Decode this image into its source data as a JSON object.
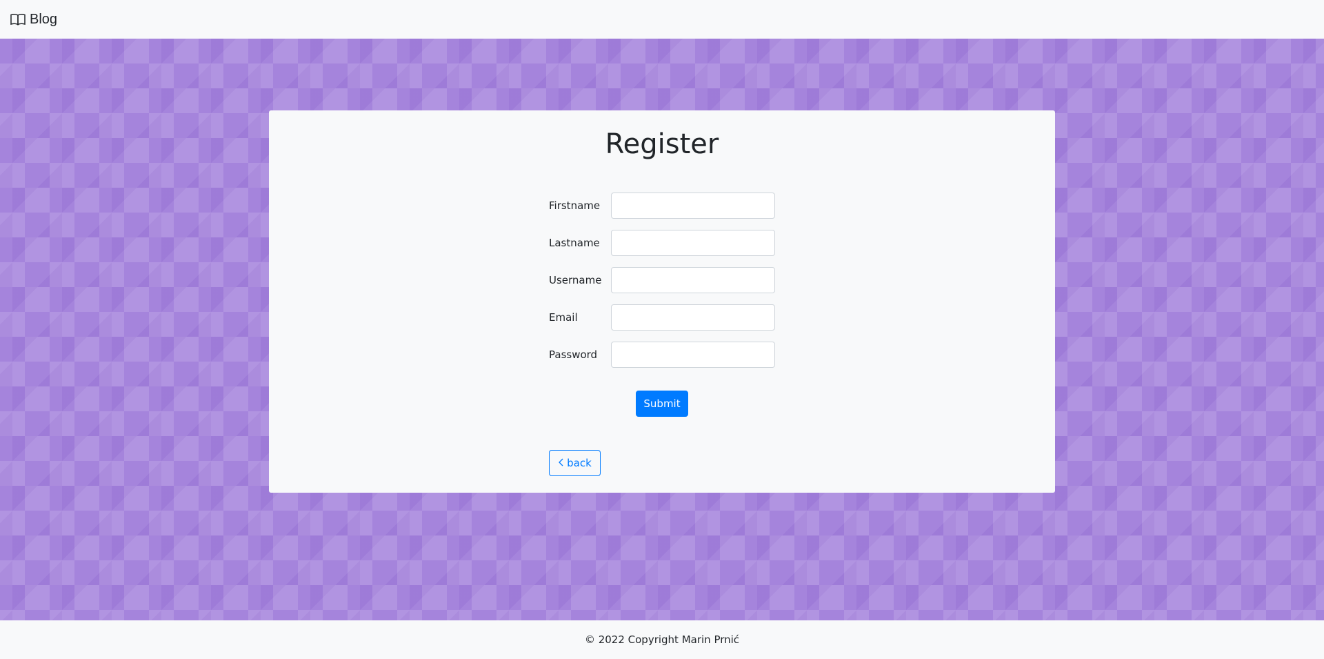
{
  "navbar": {
    "brand_label": "Blog",
    "brand_icon": "book-icon"
  },
  "form": {
    "title": "Register",
    "fields": [
      {
        "label": "Firstname",
        "value": "",
        "placeholder": ""
      },
      {
        "label": "Lastname",
        "value": "",
        "placeholder": ""
      },
      {
        "label": "Username",
        "value": "",
        "placeholder": ""
      },
      {
        "label": "Email",
        "value": "",
        "placeholder": ""
      },
      {
        "label": "Password",
        "value": "",
        "placeholder": ""
      }
    ],
    "submit_label": "Submit",
    "back_label": "back",
    "back_icon": "chevron-left-icon"
  },
  "footer": {
    "text": "© 2022 Copyright Marin Prnić"
  },
  "colors": {
    "primary": "#007bff",
    "background_pattern": "#a584dc",
    "light": "#f8f9fa"
  }
}
